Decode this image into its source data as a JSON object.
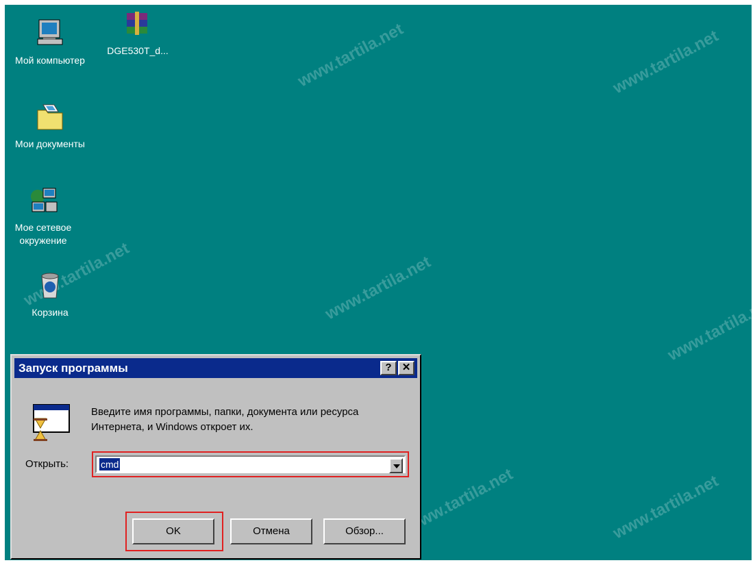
{
  "desktop": {
    "background": "#008080",
    "watermark": "www.tartila.net",
    "icons": [
      {
        "label": "Мой компьютер",
        "icon": "my-computer-icon"
      },
      {
        "label": "DGE530T_d...",
        "icon": "winrar-archive-icon"
      },
      {
        "label": "Мои документы",
        "icon": "my-documents-folder-icon"
      },
      {
        "label": "Мое сетевое окружение",
        "icon": "network-neighborhood-icon"
      },
      {
        "label": "Корзина",
        "icon": "recycle-bin-icon"
      }
    ]
  },
  "dialog": {
    "title": "Запуск программы",
    "help_button": "?",
    "close_button": "✕",
    "message": "Введите имя программы, папки, документа или ресурса Интернета, и Windows откроет их.",
    "open_label": "Открыть:",
    "open_value": "cmd",
    "buttons": {
      "ok": "OK",
      "cancel": "Отмена",
      "browse": "Обзор..."
    },
    "highlight_color": "#e02020",
    "title_color": "#0a2a8c"
  }
}
